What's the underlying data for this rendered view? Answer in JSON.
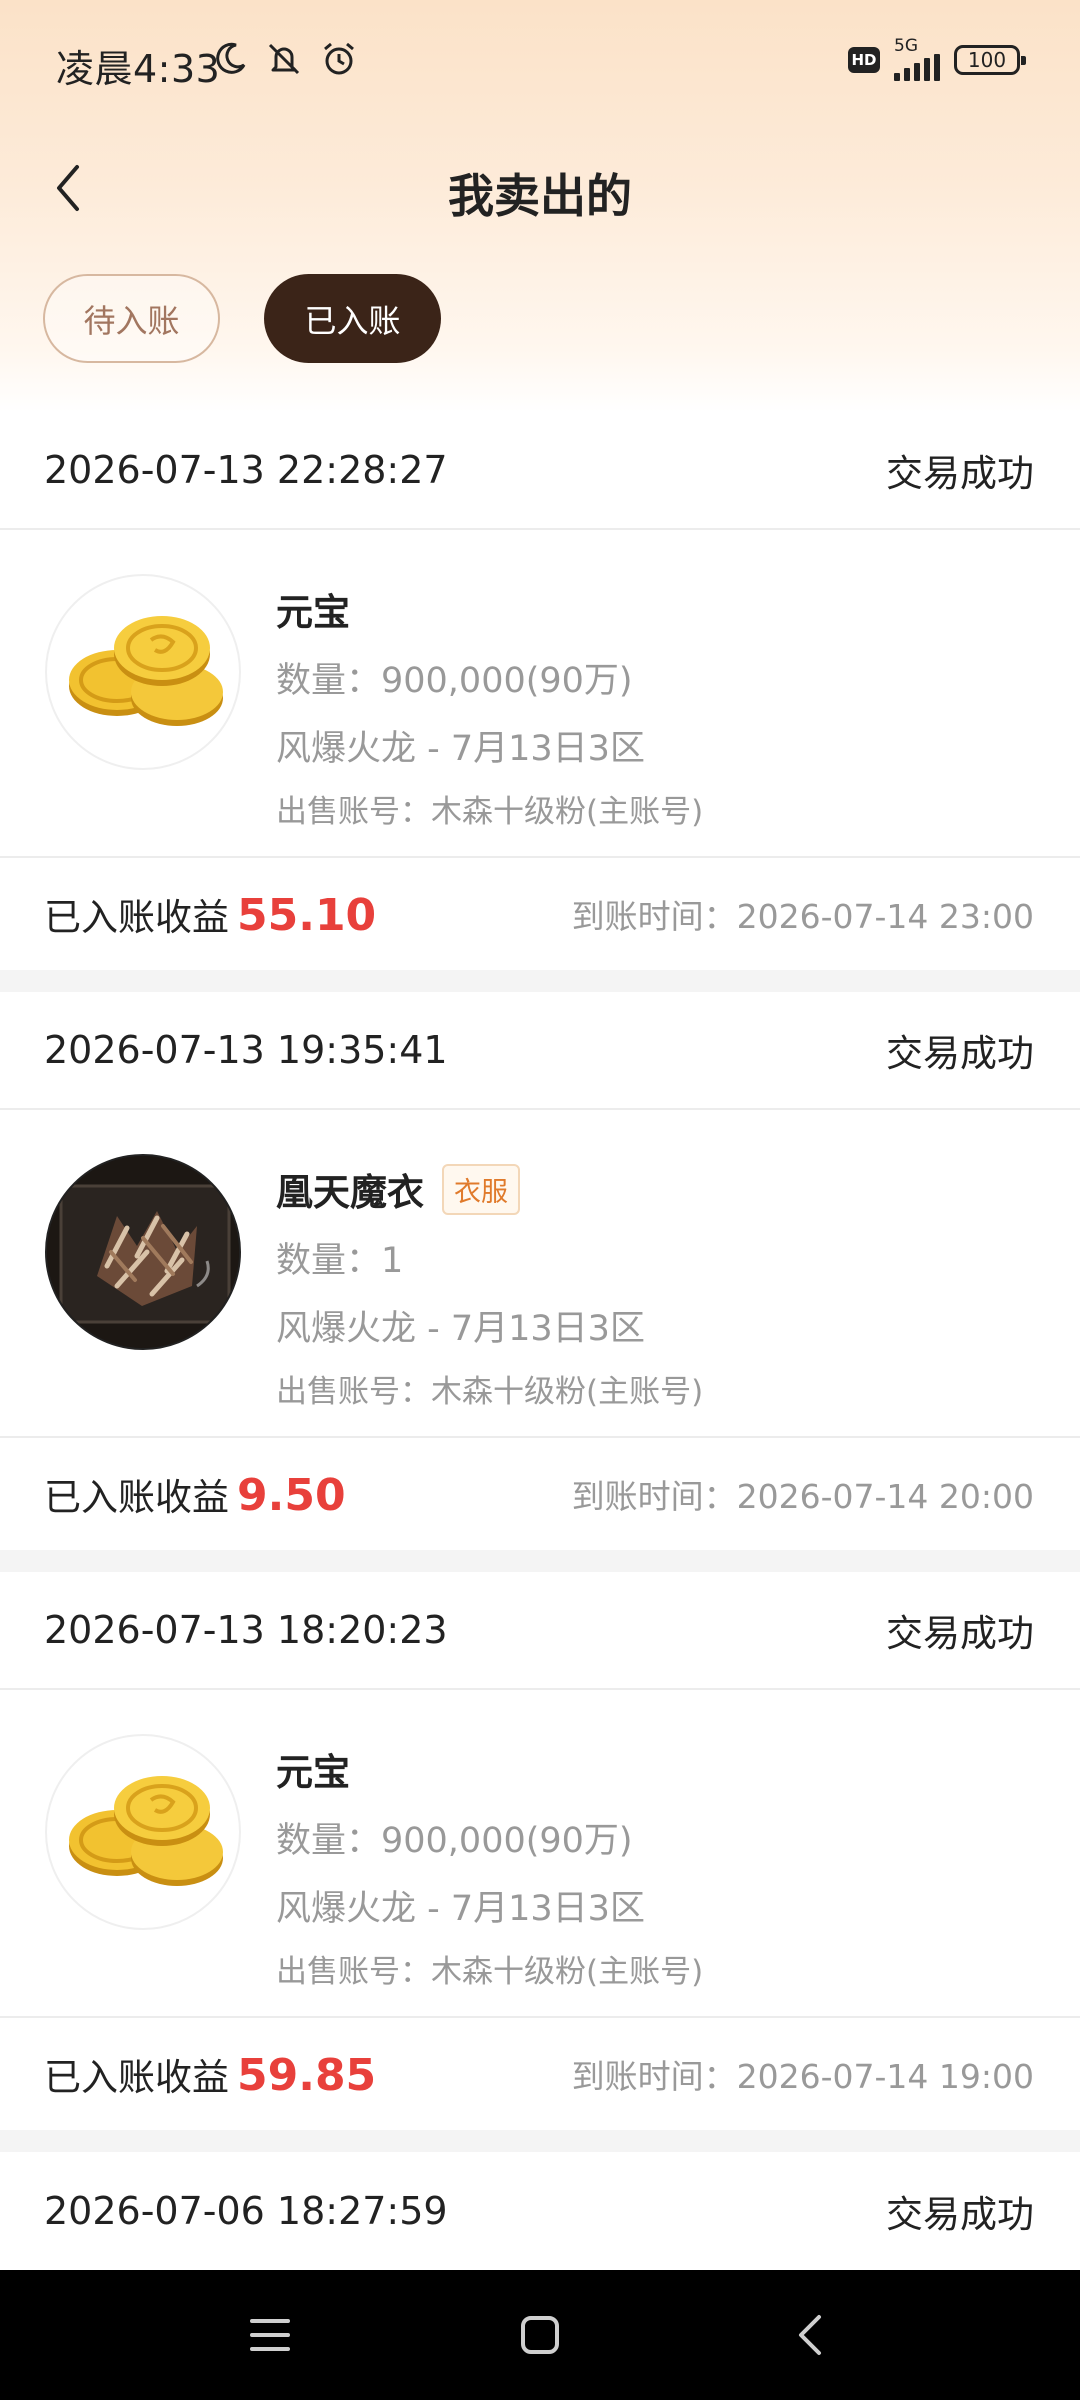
{
  "status_bar": {
    "time": "凌晨4:33",
    "hd": "HD",
    "network": "5G",
    "battery": "100"
  },
  "nav": {
    "title": "我卖出的"
  },
  "tabs": [
    {
      "label": "待入账",
      "active": false
    },
    {
      "label": "已入账",
      "active": true
    }
  ],
  "orders": [
    {
      "datetime": "2026-07-13 22:28:27",
      "status": "交易成功",
      "item_name": "元宝",
      "tag": "",
      "quantity": "数量：900,000(90万)",
      "server": "风爆火龙 - 7月13日3区",
      "account": "出售账号：木森十级粉(主账号)",
      "income_label": "已入账收益",
      "income": "55.10",
      "arrive_time": "到账时间：2026-07-14 23:00",
      "icon": "gold-coins-icon"
    },
    {
      "datetime": "2026-07-13 19:35:41",
      "status": "交易成功",
      "item_name": "凰天魔衣",
      "tag": "衣服",
      "quantity": "数量：1",
      "server": "风爆火龙 - 7月13日3区",
      "account": "出售账号：木森十级粉(主账号)",
      "income_label": "已入账收益",
      "income": "9.50",
      "arrive_time": "到账时间：2026-07-14 20:00",
      "icon": "armor-robe-icon"
    },
    {
      "datetime": "2026-07-13 18:20:23",
      "status": "交易成功",
      "item_name": "元宝",
      "tag": "",
      "quantity": "数量：900,000(90万)",
      "server": "风爆火龙 - 7月13日3区",
      "account": "出售账号：木森十级粉(主账号)",
      "income_label": "已入账收益",
      "income": "59.85",
      "arrive_time": "到账时间：2026-07-14 19:00",
      "icon": "gold-coins-icon"
    },
    {
      "datetime": "2026-07-06 18:27:59",
      "status": "交易成功"
    }
  ],
  "colors": {
    "accent_dark": "#3b2418",
    "income_red": "#e8403b",
    "tag_orange": "#e07a2b"
  }
}
